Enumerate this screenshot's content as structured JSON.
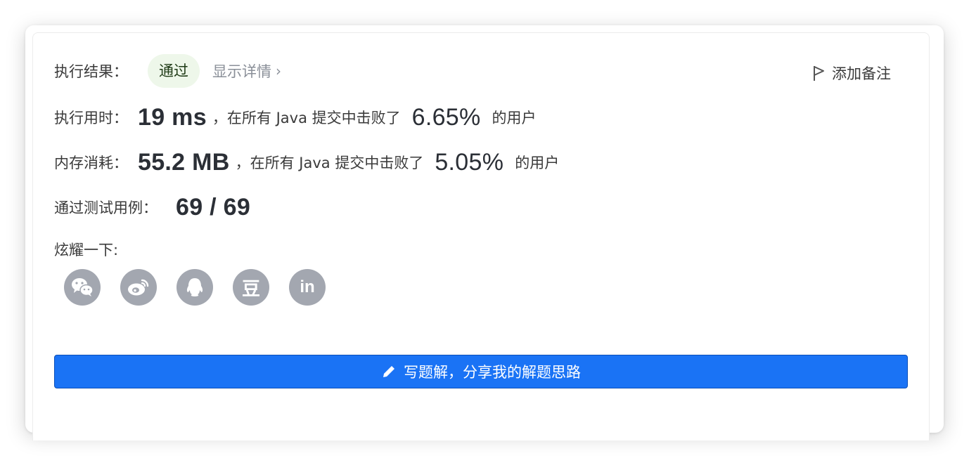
{
  "result": {
    "label": "执行结果：",
    "status": "通过",
    "detail_link": "显示详情",
    "add_note": "添加备注"
  },
  "runtime": {
    "label": "执行用时：",
    "value": "19 ms",
    "suffix_before": "，在所有 Java 提交中击败了",
    "percent": "6.65%",
    "suffix_after": "的用户"
  },
  "memory": {
    "label": "内存消耗：",
    "value": "55.2 MB",
    "suffix_before": "，在所有 Java 提交中击败了",
    "percent": "5.05%",
    "suffix_after": "的用户"
  },
  "tests": {
    "label": "通过测试用例：",
    "value": "69 / 69"
  },
  "share": {
    "label": "炫耀一下:",
    "icons": [
      {
        "name": "wechat-icon"
      },
      {
        "name": "weibo-icon"
      },
      {
        "name": "qq-icon"
      },
      {
        "name": "douban-icon",
        "text": "豆"
      },
      {
        "name": "linkedin-icon",
        "text": "in"
      }
    ]
  },
  "write_button": {
    "label": "写题解，分享我的解题思路",
    "icon": "pencil-icon"
  },
  "colors": {
    "accent": "#1a73f5",
    "pass_bg": "#eef7ea",
    "icon_gray": "#a3a7b0"
  }
}
